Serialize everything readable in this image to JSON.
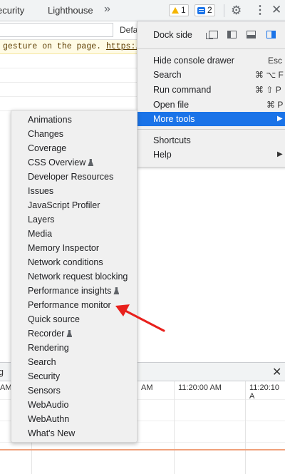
{
  "tabbar": {
    "tab_security": "ecurity",
    "tab_lighthouse": "Lighthouse",
    "overflow": "»",
    "warnings_count": "1",
    "messages_count": "2"
  },
  "console": {
    "filter_placeholder": "",
    "default_levels": "Defa",
    "warning_text": "gesture on the page.",
    "warning_link": "https:/"
  },
  "main_menu": {
    "dock_side": "Dock side",
    "items": [
      {
        "label": "Hide console drawer",
        "shortcut": "Esc"
      },
      {
        "label": "Search",
        "shortcut": "⌘ ⌥ F"
      },
      {
        "label": "Run command",
        "shortcut": "⌘ ⇧ P"
      },
      {
        "label": "Open file",
        "shortcut": "⌘ P"
      },
      {
        "label": "More tools",
        "shortcut": "▶"
      },
      {
        "label": "Shortcuts",
        "shortcut": ""
      },
      {
        "label": "Help",
        "shortcut": "▶"
      }
    ]
  },
  "more_tools": {
    "items": [
      "Animations",
      "Changes",
      "Coverage",
      "CSS Overview",
      "Developer Resources",
      "Issues",
      "JavaScript Profiler",
      "Layers",
      "Media",
      "Memory Inspector",
      "Network conditions",
      "Network request blocking",
      "Performance insights",
      "Performance monitor",
      "Quick source",
      "Recorder",
      "Rendering",
      "Search",
      "Security",
      "Sensors",
      "WebAudio",
      "WebAuthn",
      "What's New"
    ]
  },
  "drawer": {
    "tab_label": "g",
    "time_labels": [
      "AM",
      "AM",
      "11:20:00 AM",
      "11:20:10 A"
    ]
  },
  "colors": {
    "accent": "#1a73e8",
    "warning": "#f4b400",
    "annotation_arrow": "#e8201c",
    "perf_line": "#f0a07a"
  }
}
